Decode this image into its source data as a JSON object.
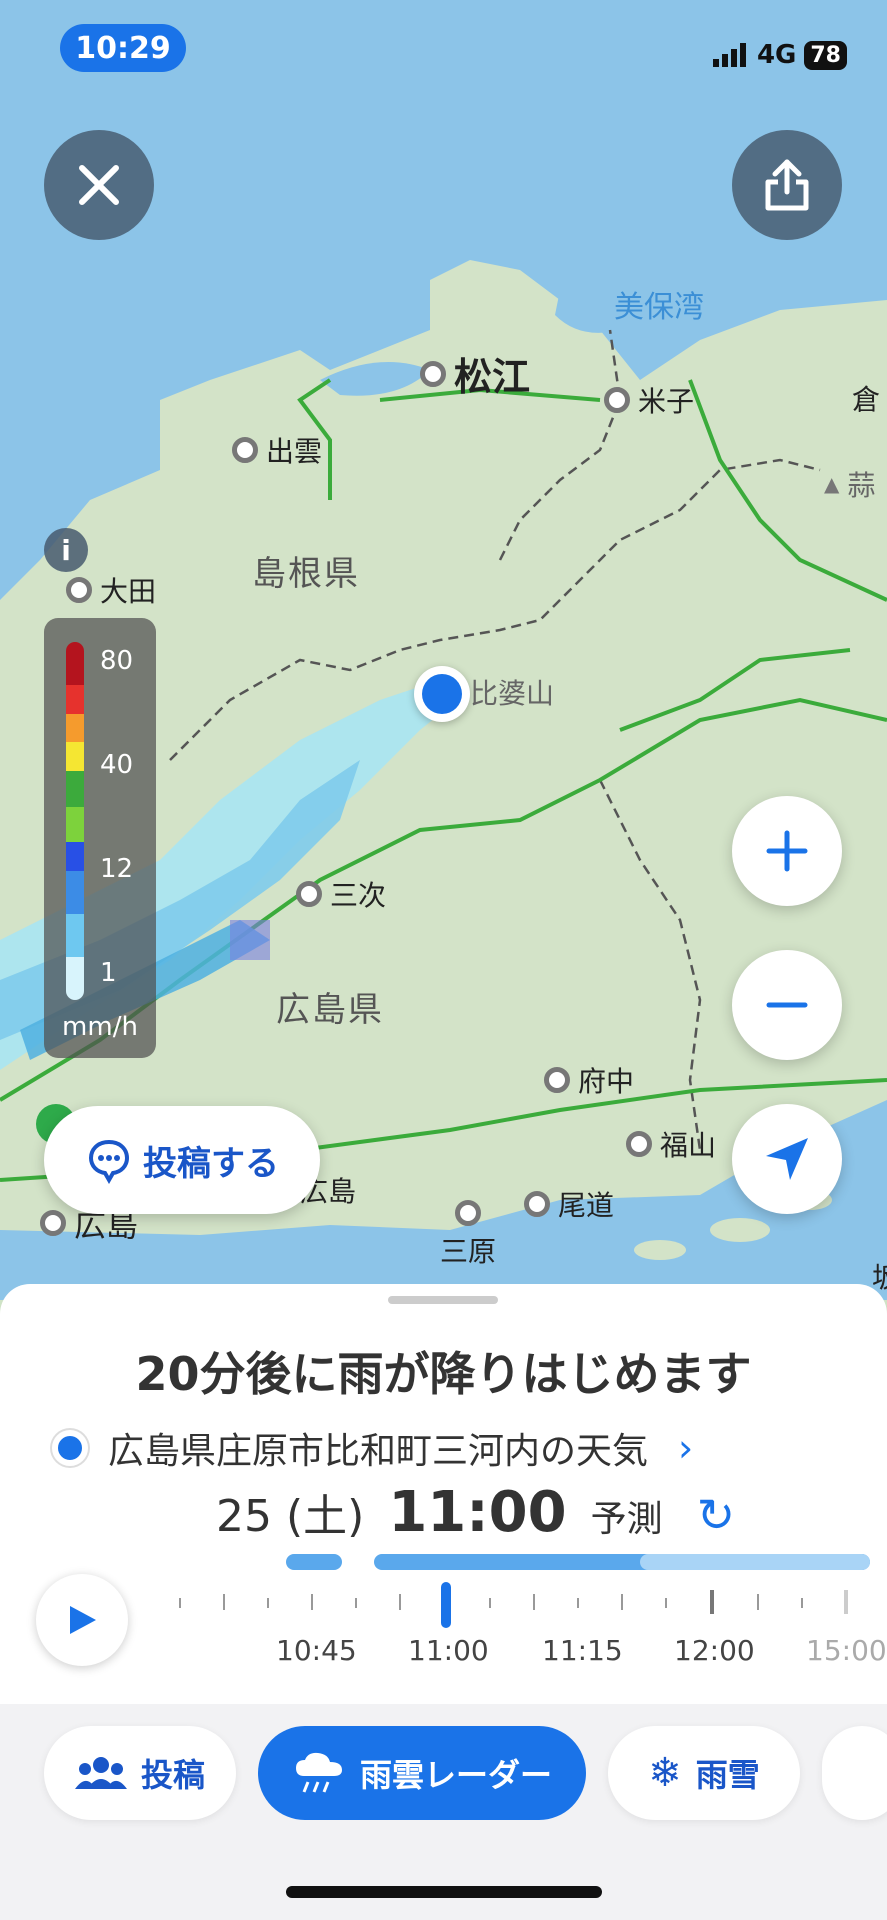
{
  "status_bar": {
    "time": "10:29",
    "network": "4G",
    "battery": "78"
  },
  "map": {
    "places": [
      {
        "id": "matsue",
        "label": "松江"
      },
      {
        "id": "yonago",
        "label": "米子"
      },
      {
        "id": "izumo",
        "label": "出雲"
      },
      {
        "id": "oda",
        "label": "大田"
      },
      {
        "id": "hibayama",
        "label": "比婆山"
      },
      {
        "id": "miyoshi",
        "label": "三次"
      },
      {
        "id": "fuchu",
        "label": "府中"
      },
      {
        "id": "fukuyama",
        "label": "福山"
      },
      {
        "id": "onomichi",
        "label": "尾道"
      },
      {
        "id": "mihara",
        "label": "三原"
      },
      {
        "id": "hiroshima",
        "label": "広島"
      },
      {
        "id": "higashihiroshima",
        "label": "広島"
      },
      {
        "id": "kura",
        "label": "倉"
      },
      {
        "id": "hiru",
        "label": "蒜"
      },
      {
        "id": "edge",
        "label": "坂"
      }
    ],
    "bay": "美保湾",
    "prefectures": [
      "島根県",
      "広島県"
    ]
  },
  "legend": {
    "labels": [
      "80",
      "40",
      "12",
      "1"
    ],
    "unit": "mm/h"
  },
  "post_button": "投稿する",
  "sheet": {
    "headline": "20分後に雨が降りはじめます",
    "location": "広島県庄原市比和町三河内の天気",
    "date": "25 (土)",
    "time": "11:00",
    "forecast": "予測",
    "tick_labels": [
      "10:45",
      "11:00",
      "11:15",
      "12:00",
      "15:00"
    ]
  },
  "tabs": [
    {
      "label": "投稿",
      "icon": "people-icon"
    },
    {
      "label": "雨雲レーダー",
      "icon": "rain-cloud-icon"
    },
    {
      "label": "雨雪",
      "icon": "snow-rain-icon"
    }
  ],
  "colors": {
    "accent": "#1a73e8",
    "sea": "#8cc4e8",
    "land": "#d3e3c8"
  }
}
